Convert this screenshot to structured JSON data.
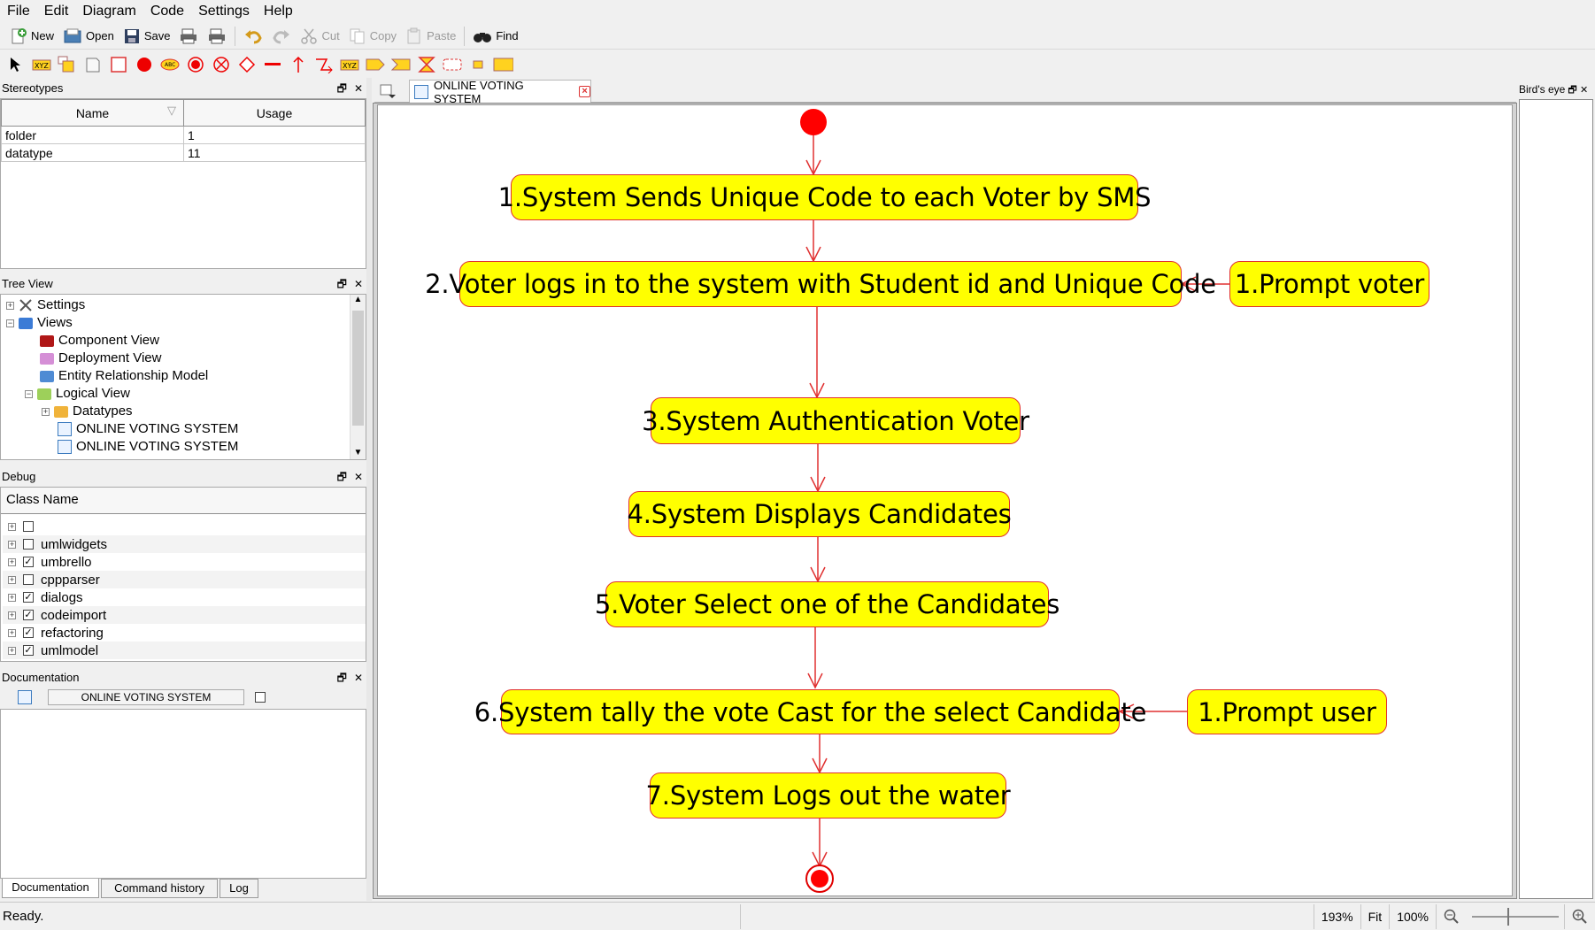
{
  "menu": [
    "File",
    "Edit",
    "Diagram",
    "Code",
    "Settings",
    "Help"
  ],
  "toolbar": {
    "new": "New",
    "open": "Open",
    "save": "Save",
    "cut": "Cut",
    "copy": "Copy",
    "paste": "Paste",
    "find": "Find"
  },
  "stereotypes": {
    "title": "Stereotypes",
    "columns": [
      "Name",
      "Usage"
    ],
    "rows": [
      {
        "name": "folder",
        "usage": "1"
      },
      {
        "name": "datatype",
        "usage": "11"
      }
    ]
  },
  "tree": {
    "title": "Tree View",
    "items": [
      "Settings",
      "Views",
      "Component View",
      "Deployment View",
      "Entity Relationship Model",
      "Logical View",
      "Datatypes",
      "ONLINE VOTING SYSTEM",
      "ONLINE VOTING SYSTEM"
    ]
  },
  "debug": {
    "title": "Debug",
    "header": "Class Name",
    "rows": [
      {
        "name": "",
        "checked": false
      },
      {
        "name": "umlwidgets",
        "checked": false
      },
      {
        "name": "umbrello",
        "checked": true
      },
      {
        "name": "cppparser",
        "checked": false
      },
      {
        "name": "dialogs",
        "checked": true
      },
      {
        "name": "codeimport",
        "checked": true
      },
      {
        "name": "refactoring",
        "checked": true
      },
      {
        "name": "umlmodel",
        "checked": true
      }
    ]
  },
  "documentation": {
    "title": "Documentation",
    "name": "ONLINE VOTING SYSTEM"
  },
  "bottom_tabs": [
    "Documentation",
    "Command history",
    "Log"
  ],
  "diagram_tab": "ONLINE VOTING SYSTEM",
  "birds_eye": "Bird's eye",
  "activities": [
    "1.System Sends Unique Code to each Voter by SMS",
    "2.Voter logs in to the system with Student id and Unique Code",
    "1.Prompt voter",
    "3.System Authentication Voter",
    "4.System Displays Candidates",
    "5.Voter Select one of the Candidates",
    "6.System tally the vote Cast for the select Candidate",
    "1.Prompt user",
    "7.System Logs out the water"
  ],
  "status": {
    "message": "Ready.",
    "zoom": "193%",
    "fit": "Fit",
    "actual": "100%"
  },
  "colors": {
    "activity_fill": "#ffff00",
    "activity_border": "#e03030",
    "node_red": "#ff0000"
  }
}
